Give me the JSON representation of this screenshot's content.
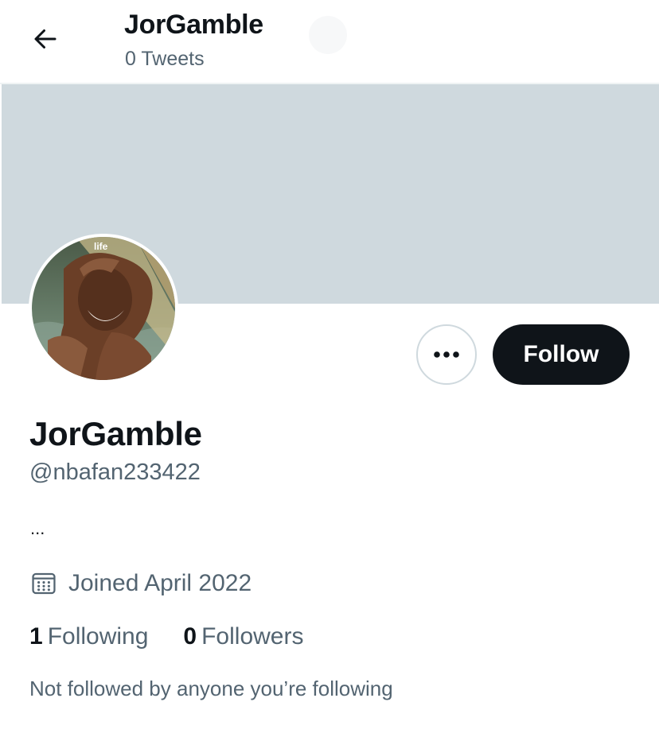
{
  "header": {
    "title": "JorGamble",
    "tweet_count": "0 Tweets",
    "back_icon": "arrow-left-icon"
  },
  "profile": {
    "avatar_caption": "life",
    "display_name": "JorGamble",
    "handle": "@nbafan233422",
    "bio": "...",
    "joined": "Joined April 2022",
    "joined_icon": "calendar-icon",
    "following_count": "1",
    "following_label": "Following",
    "followers_count": "0",
    "followers_label": "Followers",
    "followed_by_note": "Not followed by anyone you’re following"
  },
  "actions": {
    "more_icon": "more-options-icon",
    "follow_label": "Follow"
  },
  "colors": {
    "banner": "#cfd9de",
    "follow_button": "#0f1419",
    "secondary_text": "#536471"
  }
}
